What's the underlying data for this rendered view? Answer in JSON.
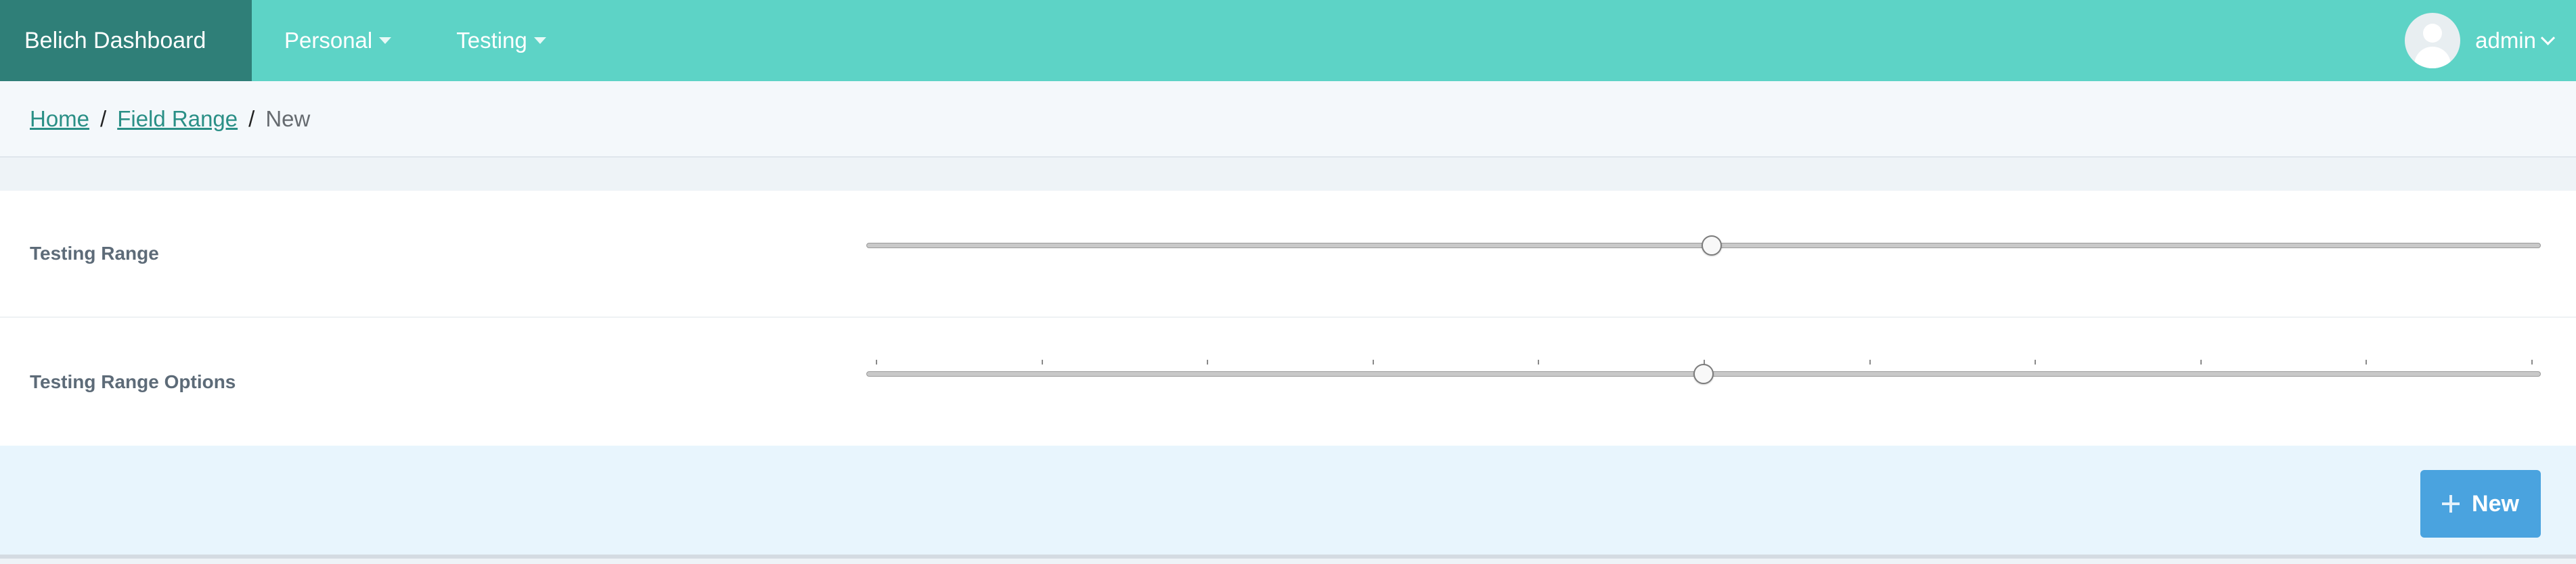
{
  "navbar": {
    "brand": "Belich Dashboard",
    "menu": [
      {
        "label": "Personal"
      },
      {
        "label": "Testing"
      }
    ],
    "user": {
      "name": "admin"
    }
  },
  "breadcrumb": {
    "home": "Home",
    "section": "Field Range",
    "current": "New",
    "separator": "/"
  },
  "form": {
    "fields": [
      {
        "label": "Testing Range",
        "value_fraction": 0.505,
        "tick_marks": 0
      },
      {
        "label": "Testing Range Options",
        "value_fraction": 0.5,
        "tick_marks": 11
      }
    ]
  },
  "footer": {
    "new_button_label": "New",
    "new_button_icon": "plus-icon"
  },
  "colors": {
    "navbar": "#5dd3c6",
    "brand": "#2f7f78",
    "link": "#2a8f86",
    "primary_button": "#4aa3df"
  }
}
